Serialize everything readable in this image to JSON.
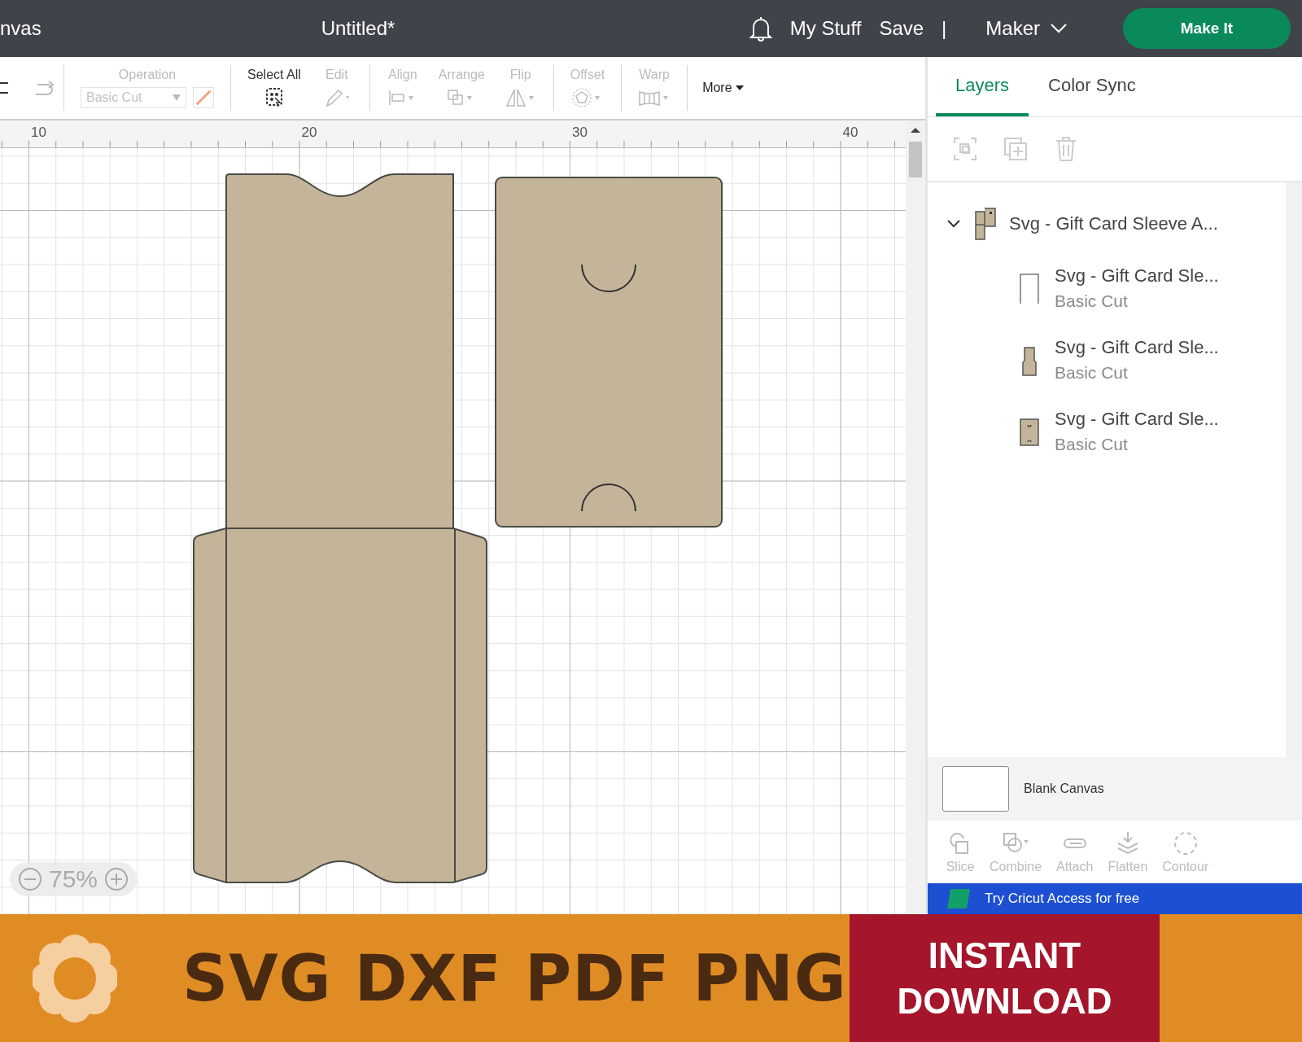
{
  "topbar": {
    "title_partial": "nvas",
    "document_title": "Untitled*",
    "links": [
      "My Stuff",
      "Save"
    ],
    "separator": "|",
    "machine": "Maker",
    "make_button": "Make It"
  },
  "toolbar": {
    "items": [
      {
        "kind": "undo",
        "disabled": false
      },
      {
        "kind": "redo",
        "disabled": true
      },
      {
        "kind": "operation",
        "label": "Operation",
        "value": "Basic Cut",
        "disabled": true
      },
      {
        "kind": "select-all",
        "label": "Select All",
        "disabled": false
      },
      {
        "kind": "edit",
        "label": "Edit",
        "disabled": true
      },
      {
        "kind": "align",
        "label": "Align",
        "disabled": true
      },
      {
        "kind": "arrange",
        "label": "Arrange",
        "disabled": true
      },
      {
        "kind": "flip",
        "label": "Flip",
        "disabled": true
      },
      {
        "kind": "offset",
        "label": "Offset",
        "disabled": true
      },
      {
        "kind": "warp",
        "label": "Warp",
        "disabled": true
      }
    ],
    "more": "More"
  },
  "canvas": {
    "ruler": [
      "10",
      "20",
      "30",
      "40"
    ],
    "zoom": "75%"
  },
  "panel": {
    "tabs": [
      {
        "label": "Layers",
        "selected": true
      },
      {
        "label": "Color Sync",
        "selected": false
      }
    ],
    "layers": [
      {
        "kind": "group",
        "name": "Svg - Gift Card Sleeve A...",
        "expanded": true,
        "children": [
          {
            "kind": "outline",
            "name": "Svg - Gift Card Sle...",
            "operation": "Basic Cut"
          },
          {
            "kind": "strip",
            "name": "Svg - Gift Card Sle...",
            "operation": "Basic Cut"
          },
          {
            "kind": "card",
            "name": "Svg - Gift Card Sle...",
            "operation": "Basic Cut"
          }
        ]
      }
    ],
    "canvas_label": "Blank Canvas",
    "actions": [
      {
        "kind": "slice",
        "label": "Slice",
        "disabled": true
      },
      {
        "kind": "combine",
        "label": "Combine",
        "disabled": true
      },
      {
        "kind": "attach",
        "label": "Attach",
        "disabled": true
      },
      {
        "kind": "flatten",
        "label": "Flatten",
        "disabled": true
      },
      {
        "kind": "contour",
        "label": "Contour",
        "disabled": true
      }
    ],
    "promo": "Try Cricut Access for free"
  },
  "banner": {
    "formats": "SVG DXF PDF PNG",
    "cta": "INSTANT DOWNLOAD"
  }
}
